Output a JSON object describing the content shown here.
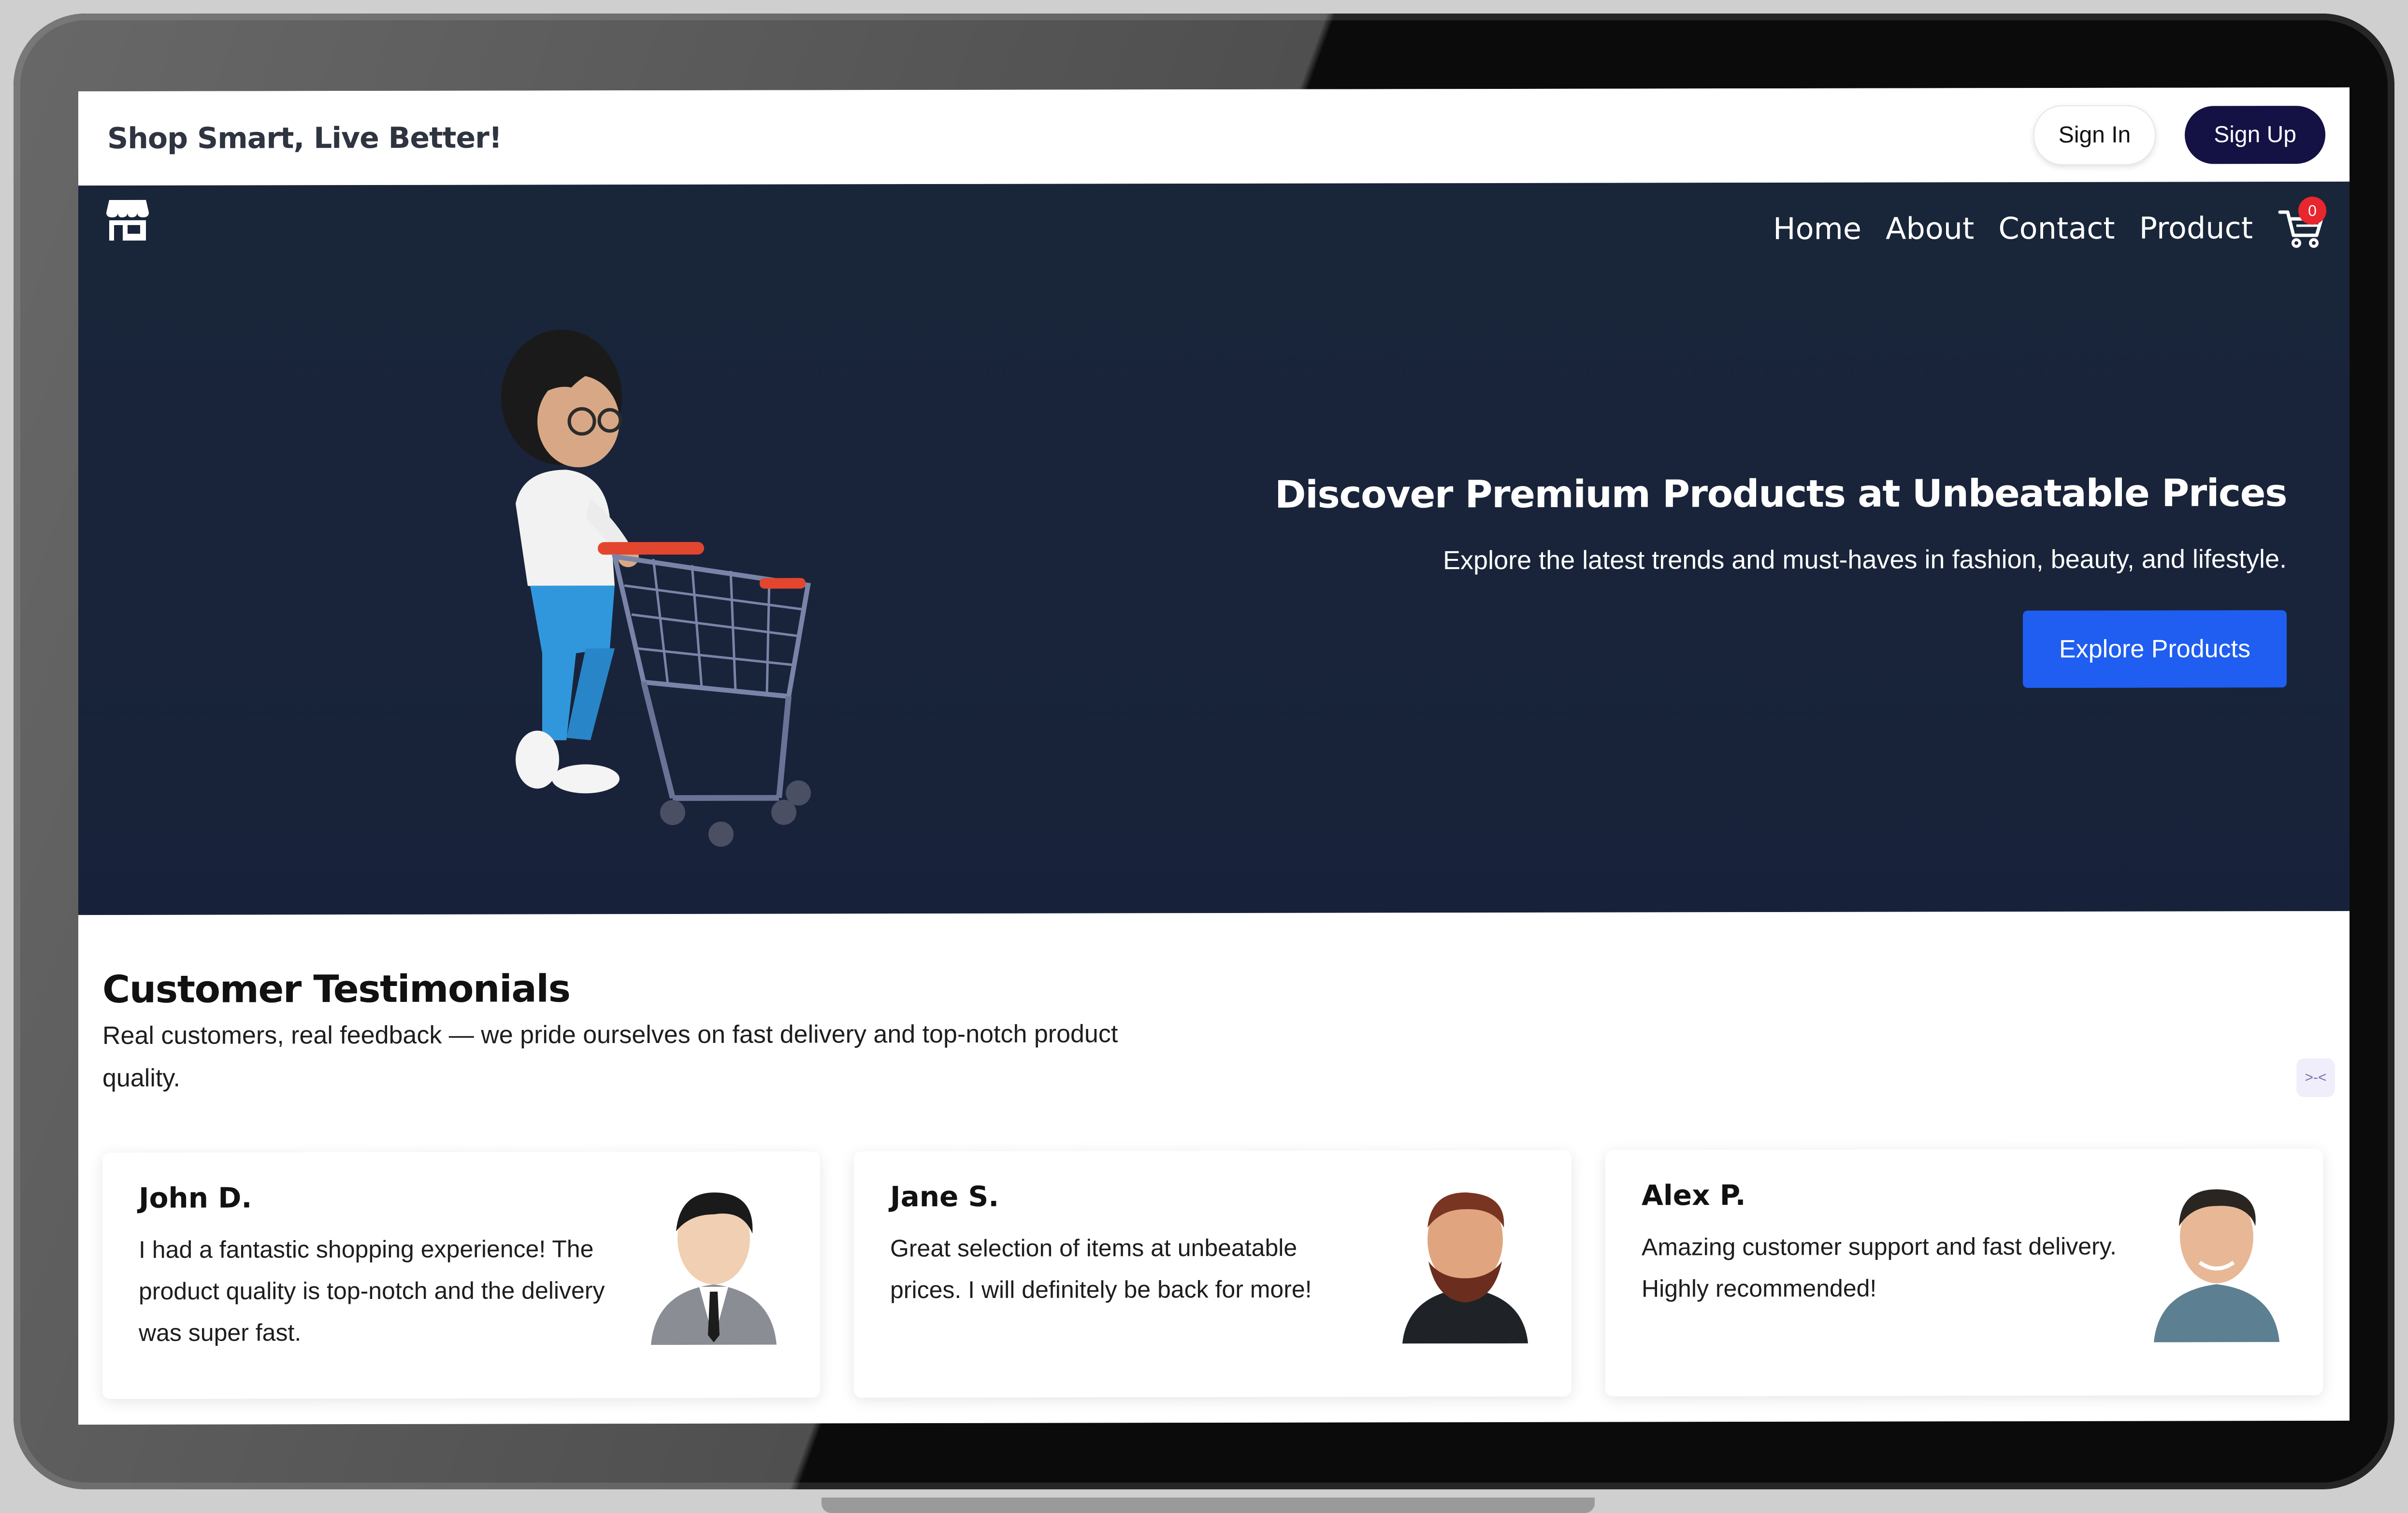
{
  "topbar": {
    "tagline": "Shop Smart, Live Better!",
    "signin_label": "Sign In",
    "signup_label": "Sign Up"
  },
  "nav": {
    "links": [
      "Home",
      "About",
      "Contact",
      "Product"
    ],
    "cart_count": "0",
    "logo_icon": "store-icon",
    "cart_icon": "shopping-cart-icon"
  },
  "hero": {
    "title": "Discover Premium Products at Unbeatable Prices",
    "subtitle": "Explore the latest trends and must-haves in fashion, beauty, and lifestyle.",
    "cta_label": "Explore Products",
    "illustration": "person-pushing-shopping-cart"
  },
  "testimonials": {
    "title": "Customer Testimonials",
    "subtitle": "Real customers, real feedback — we pride ourselves on fast delivery and top-notch product quality.",
    "chat_icon": "chat-widget-icon",
    "items": [
      {
        "name": "John D.",
        "text": "I had a fantastic shopping experience! The product quality is top-notch and the delivery was super fast."
      },
      {
        "name": "Jane S.",
        "text": "Great selection of items at unbeatable prices. I will definitely be back for more!"
      },
      {
        "name": "Alex P.",
        "text": "Amazing customer support and fast delivery. Highly recommended!"
      }
    ]
  },
  "colors": {
    "hero_bg": "#19243a",
    "primary_button": "#1f5ef0",
    "signup_button": "#141244",
    "badge": "#e8262d"
  }
}
